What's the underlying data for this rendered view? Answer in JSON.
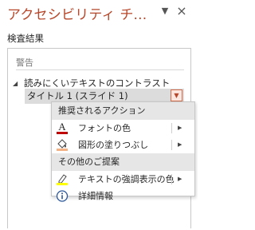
{
  "pane": {
    "title": "アクセシビリティ チ...",
    "menu_glyph": "▼",
    "close_glyph": "×"
  },
  "results": {
    "section_label": "検査結果",
    "category": "警告",
    "group": {
      "expander": "◢",
      "label": "読みにくいテキストのコントラスト"
    },
    "item": {
      "label": "タイトル 1 (スライド 1)",
      "dropdown_glyph": "▼"
    }
  },
  "context_menu": {
    "recommended_header": "推奨されるアクション",
    "other_header": "その他のご提案",
    "items": [
      {
        "label": "フォントの色",
        "icon": "font-color-icon",
        "submenu_glyph": "▶"
      },
      {
        "label": "図形の塗りつぶし",
        "icon": "shape-fill-icon",
        "submenu_glyph": "▶"
      },
      {
        "label": "テキストの強調表示の色",
        "icon": "highlight-color-icon",
        "submenu_glyph": "▶"
      },
      {
        "label": "詳細情報",
        "icon": "info-icon"
      }
    ]
  },
  "colors": {
    "accent": "#b7472a",
    "font_color_bar": "#c00000",
    "fill_color_bar": "#f4b183",
    "highlight_bar": "#ffff00",
    "info_icon": "#2b579a"
  }
}
